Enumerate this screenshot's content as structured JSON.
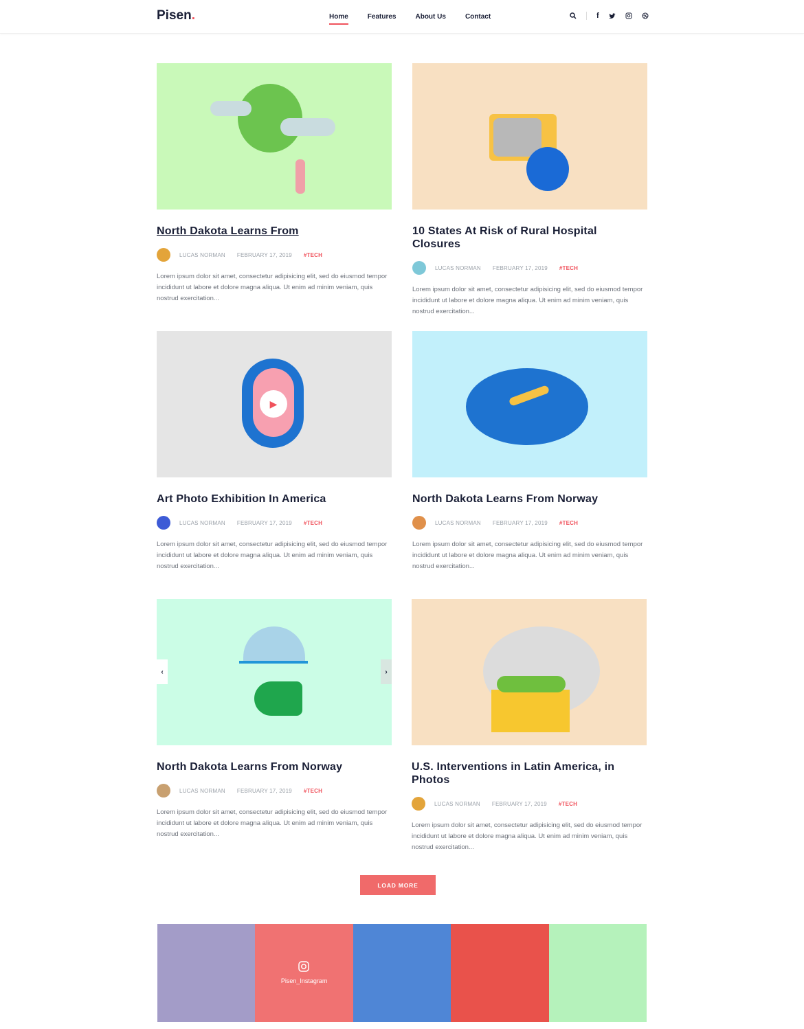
{
  "header": {
    "logo": "Pisen",
    "logo_dot": ".",
    "nav": [
      {
        "label": "Home"
      },
      {
        "label": "Features"
      },
      {
        "label": "About Us"
      },
      {
        "label": "Contact"
      }
    ],
    "icons": [
      "search-icon",
      "facebook-icon",
      "twitter-icon",
      "instagram-icon",
      "dribbble-icon"
    ]
  },
  "colors": {
    "accent": "#f0525c",
    "button": "#f06a6a"
  },
  "posts": [
    {
      "title": "North Dakota Learns From",
      "author": "LUCAS NORMAN",
      "date": "FEBRUARY 17, 2019",
      "tag": "#TECH",
      "excerpt": "Lorem ipsum dolor sit amet, consectetur adipisicing elit, sed do eiusmod tempor incididunt ut labore et dolore magna aliqua. Ut enim ad minim veniam, quis nostrud exercitation...",
      "bg": "#c9f9b9"
    },
    {
      "title": "10 States At Risk of Rural Hospital Closures",
      "author": "LUCAS NORMAN",
      "date": "FEBRUARY 17, 2019",
      "tag": "#TECH",
      "excerpt": "Lorem ipsum dolor sit amet, consectetur adipisicing elit, sed do eiusmod tempor incididunt ut labore et dolore magna aliqua. Ut enim ad minim veniam, quis nostrud exercitation...",
      "bg": "#f8e0c2"
    },
    {
      "title": "Art Photo Exhibition In America",
      "author": "LUCAS NORMAN",
      "date": "FEBRUARY 17, 2019",
      "tag": "#TECH",
      "excerpt": "Lorem ipsum dolor sit amet, consectetur adipisicing elit, sed do eiusmod tempor incididunt ut labore et dolore magna aliqua. Ut enim ad minim veniam, quis nostrud exercitation...",
      "bg": "#e5e5e5"
    },
    {
      "title": "North Dakota Learns From Norway",
      "author": "LUCAS NORMAN",
      "date": "FEBRUARY 17, 2019",
      "tag": "#TECH",
      "excerpt": "Lorem ipsum dolor sit amet, consectetur adipisicing elit, sed do eiusmod tempor incididunt ut labore et dolore magna aliqua. Ut enim ad minim veniam, quis nostrud exercitation...",
      "bg": "#c2f0fb"
    },
    {
      "title": "North Dakota Learns From Norway",
      "author": "LUCAS NORMAN",
      "date": "FEBRUARY 17, 2019",
      "tag": "#TECH",
      "excerpt": "Lorem ipsum dolor sit amet, consectetur adipisicing elit, sed do eiusmod tempor incididunt ut labore et dolore magna aliqua. Ut enim ad minim veniam, quis nostrud exercitation...",
      "bg": "#cbfde6"
    },
    {
      "title": "U.S. Interventions in Latin America, in Photos",
      "author": "LUCAS NORMAN",
      "date": "FEBRUARY 17, 2019",
      "tag": "#TECH",
      "excerpt": "Lorem ipsum dolor sit amet, consectetur adipisicing elit, sed do eiusmod tempor incididunt ut labore et dolore magna aliqua. Ut enim ad minim veniam, quis nostrud exercitation...",
      "bg": "#f8e0c2"
    }
  ],
  "slider": {
    "prev": "‹",
    "next": "›"
  },
  "load_more": "LOAD MORE",
  "instagram": {
    "label": "Pisen_Instagram",
    "tiles": [
      "#a39cc8",
      "#f07272",
      "#4f86d6",
      "#e9524b",
      "#b5f2bb"
    ]
  }
}
